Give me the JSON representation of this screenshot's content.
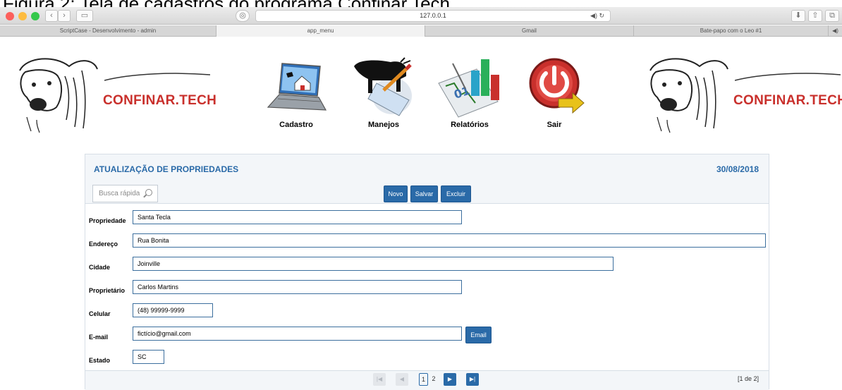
{
  "caption": "Figura 2: Tela de cadastros do programa Confinar.Tech.",
  "browser": {
    "address": "127.0.0.1",
    "tabs": [
      "ScriptCase - Desenvolvimento - admin",
      "app_menu",
      "Gmail",
      "Bate-papo com o Leo #1"
    ]
  },
  "brand": {
    "name": "CONFINAR.TECH"
  },
  "menu": {
    "items": [
      {
        "label": "Cadastro",
        "icon": "laptop-house-icon"
      },
      {
        "label": "Manejos",
        "icon": "cow-clipboard-icon"
      },
      {
        "label": "Relatórios",
        "icon": "report-chart-icon"
      },
      {
        "label": "Sair",
        "icon": "power-icon"
      }
    ]
  },
  "panel": {
    "title": "ATUALIZAÇÃO DE PROPRIEDADES",
    "date": "30/08/2018",
    "search_placeholder": "Busca rápida",
    "buttons": {
      "novo": "Novo",
      "salvar": "Salvar",
      "excluir": "Excluir"
    },
    "fields": [
      {
        "label": "Propriedade",
        "value": "Santa Tecla"
      },
      {
        "label": "Endereço",
        "value": "Rua Bonita"
      },
      {
        "label": "Cidade",
        "value": "Joinville"
      },
      {
        "label": "Proprietário",
        "value": "Carlos Martins"
      },
      {
        "label": "Celular",
        "value": "(48) 99999-9999"
      },
      {
        "label": "E-mail",
        "value": "fictício@gmail.com"
      },
      {
        "label": "Estado",
        "value": "SC"
      }
    ],
    "email_button": "Email",
    "pager": {
      "pages": [
        "1",
        "2"
      ],
      "current": "1",
      "info": "[1 de 2]"
    }
  },
  "colors": {
    "accent": "#2a6aa8",
    "brand": "#c9302c"
  }
}
